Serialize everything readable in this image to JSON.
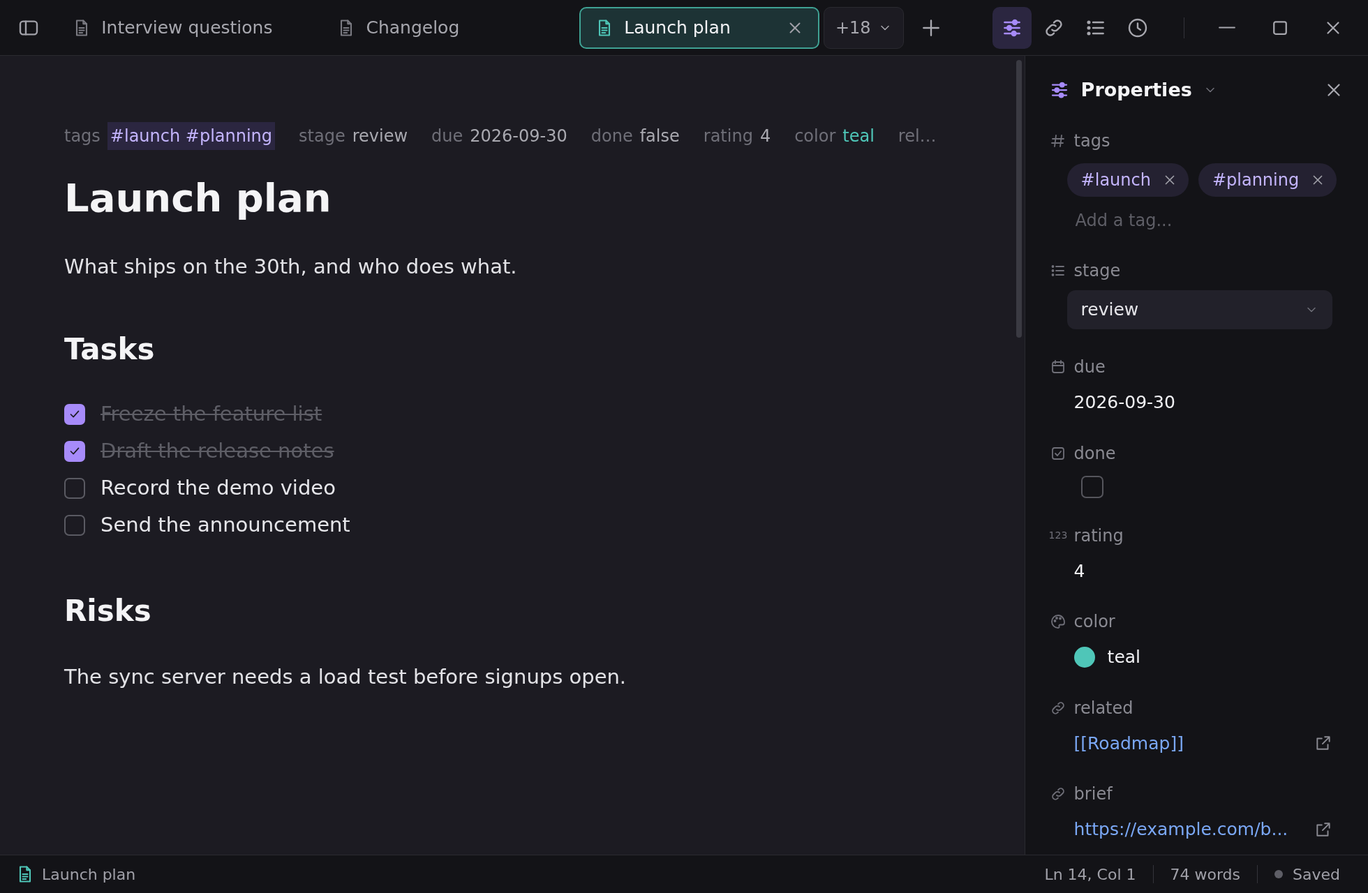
{
  "tabs": [
    {
      "label": "Interview questions",
      "selected": false
    },
    {
      "label": "Changelog",
      "selected": false
    },
    {
      "label": "Launch plan",
      "selected": true
    }
  ],
  "more_tabs": "+18",
  "toolbar": [
    {
      "kind": "properties",
      "selected": true
    },
    {
      "kind": "links",
      "selected": false
    },
    {
      "kind": "outline",
      "selected": false
    },
    {
      "kind": "history",
      "selected": false
    }
  ],
  "meta_line": [
    {
      "key": "tags",
      "value": "#launch #planning",
      "kind": "tags"
    },
    {
      "key": "stage",
      "value": "review",
      "kind": "text"
    },
    {
      "key": "due",
      "value": "2026-09-30",
      "kind": "text"
    },
    {
      "key": "done",
      "value": "false",
      "kind": "text"
    },
    {
      "key": "rating",
      "value": "4",
      "kind": "text"
    },
    {
      "key": "color",
      "value": "teal",
      "kind": "color"
    },
    {
      "key": "rel…"
    }
  ],
  "document": {
    "title": "Launch plan",
    "blocks": [
      {
        "kind": "paragraph",
        "text": "What ships on the 30th, and who does what."
      },
      {
        "kind": "heading",
        "text": "Tasks"
      },
      {
        "kind": "tasks",
        "items": [
          {
            "text": "Freeze the feature list",
            "checked": true
          },
          {
            "text": "Draft the release notes",
            "checked": true
          },
          {
            "text": "Record the demo video",
            "checked": false
          },
          {
            "text": "Send the announcement",
            "checked": false
          }
        ]
      },
      {
        "kind": "heading",
        "text": "Risks"
      },
      {
        "kind": "paragraph",
        "text": "The sync server needs a load test before signups open."
      }
    ]
  },
  "properties_panel": {
    "title": "Properties",
    "properties": [
      {
        "kind": "tags",
        "label": "tags",
        "tags": [
          "#launch",
          "#planning"
        ],
        "placeholder": "Add a tag..."
      },
      {
        "kind": "select",
        "label": "stage",
        "value": "review"
      },
      {
        "kind": "date",
        "label": "due",
        "value": "2026-09-30"
      },
      {
        "kind": "checkbox",
        "label": "done",
        "checked": false
      },
      {
        "kind": "number",
        "label": "rating",
        "value": "4",
        "icon_text": "123"
      },
      {
        "kind": "color",
        "label": "color",
        "value": "teal",
        "color": "#4fc6b8"
      },
      {
        "kind": "link",
        "label": "related",
        "value": "[[Roadmap]]"
      },
      {
        "kind": "url",
        "label": "brief",
        "value": "https://example.com/b..."
      }
    ]
  },
  "status_bar": {
    "file": "Launch plan",
    "position": "Ln 14, Col 1",
    "words": "74 words",
    "save_state": "Saved"
  }
}
